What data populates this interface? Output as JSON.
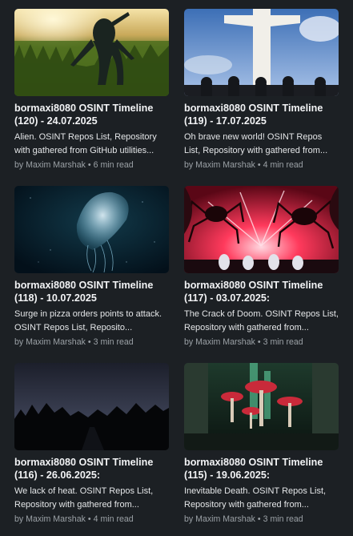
{
  "articles": [
    {
      "title": "bormaxi8080 OSINT Timeline (120) - 24.07.2025",
      "excerpt": "Alien. OSINT Repos List, Repository with gathered from GitHub utilities...",
      "author": "by Maxim Marshak",
      "separator": "•",
      "read_time": "6 min read",
      "image": "alien-in-field"
    },
    {
      "title": "bormaxi8080 OSINT Timeline (119) - 17.07.2025",
      "excerpt": "Oh brave new world! OSINT Repos List, Repository with gathered from...",
      "author": "by Maxim Marshak",
      "separator": "•",
      "read_time": "4 min read",
      "image": "statue-with-riot-police"
    },
    {
      "title": "bormaxi8080 OSINT Timeline (118) - 10.07.2025",
      "excerpt": "Surge in pizza orders points to attack. OSINT Repos List, Reposito...",
      "author": "by Maxim Marshak",
      "separator": "•",
      "read_time": "3 min read",
      "image": "jellyfish"
    },
    {
      "title": "bormaxi8080 OSINT Timeline (117) - 03.07.2025:",
      "excerpt": "The Crack of Doom. OSINT Repos List, Repository with gathered from...",
      "author": "by Maxim Marshak",
      "separator": "•",
      "read_time": "3 min read",
      "image": "giant-spiders"
    },
    {
      "title": "bormaxi8080 OSINT Timeline (116) - 26.06.2025:",
      "excerpt": "We lack of heat. OSINT Repos List, Repository with gathered from...",
      "author": "by Maxim Marshak",
      "separator": "•",
      "read_time": "4 min read",
      "image": "dark-forest-road"
    },
    {
      "title": "bormaxi8080 OSINT Timeline (115) - 19.06.2025:",
      "excerpt": "Inevitable Death. OSINT Repos List, Repository with gathered from...",
      "author": "by Maxim Marshak",
      "separator": "•",
      "read_time": "3 min read",
      "image": "mushroom-city"
    }
  ]
}
